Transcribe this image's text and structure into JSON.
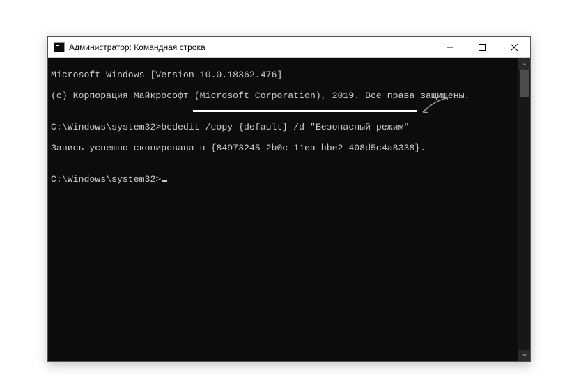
{
  "window": {
    "title": "Администратор: Командная строка"
  },
  "terminal": {
    "line0": "Microsoft Windows [Version 10.0.18362.476]",
    "line1": "(c) Корпорация Майкрософт (Microsoft Corporation), 2019. Все права защищены.",
    "blank1": "",
    "cmd1_full": "C:\\Windows\\system32>bcdedit /copy {default} /d \"Безопасный режим\"",
    "resp1": "Запись успешно скопирована в {84973245-2b0c-11ea-bbe2-408d5c4a8338}.",
    "blank2": "",
    "prompt2": "C:\\Windows\\system32>"
  }
}
